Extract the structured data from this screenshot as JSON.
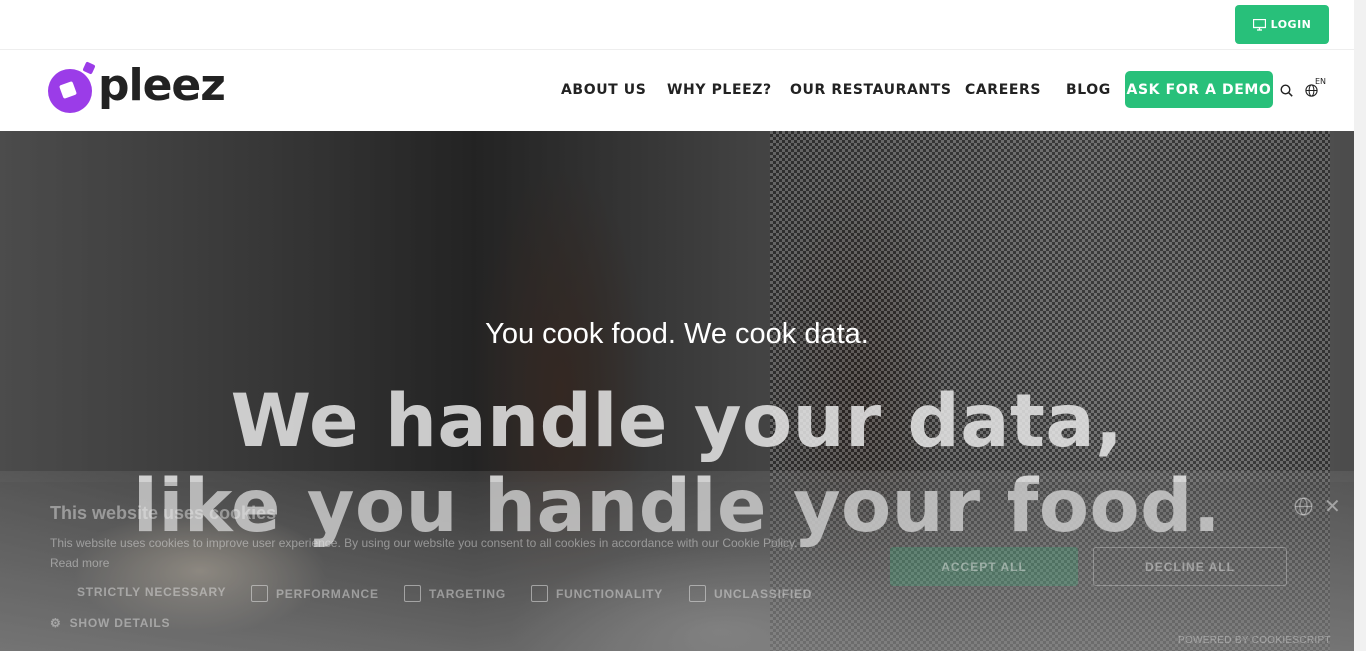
{
  "topbar": {
    "login_label": "LOGIN"
  },
  "brand": {
    "name": "pleez",
    "accent": "#9b3ce8",
    "green": "#28c07a"
  },
  "nav": {
    "items": [
      {
        "label": "ABOUT US"
      },
      {
        "label": "WHY PLEEZ?"
      },
      {
        "label": "OUR RESTAURANTS"
      },
      {
        "label": "CAREERS"
      },
      {
        "label": "BLOG"
      }
    ],
    "demo_label": "ASK FOR A DEMO",
    "language": "EN"
  },
  "hero": {
    "subtitle": "You cook food. We cook data.",
    "title_line1": "We handle your data,",
    "title_line2": "like you handle your food."
  },
  "cookie": {
    "title": "This website uses cookies",
    "text": "This website uses cookies to improve user experience. By using our website you consent to all cookies in accordance with our Cookie Policy.",
    "read_more": "Read more",
    "categories": [
      {
        "label": "STRICTLY NECESSARY"
      },
      {
        "label": "PERFORMANCE"
      },
      {
        "label": "TARGETING"
      },
      {
        "label": "FUNCTIONALITY"
      },
      {
        "label": "UNCLASSIFIED"
      }
    ],
    "show_details": "SHOW DETAILS",
    "accept_label": "ACCEPT ALL",
    "decline_label": "DECLINE ALL",
    "powered_by": "POWERED BY COOKIESCRIPT",
    "close_symbol": "✕"
  }
}
